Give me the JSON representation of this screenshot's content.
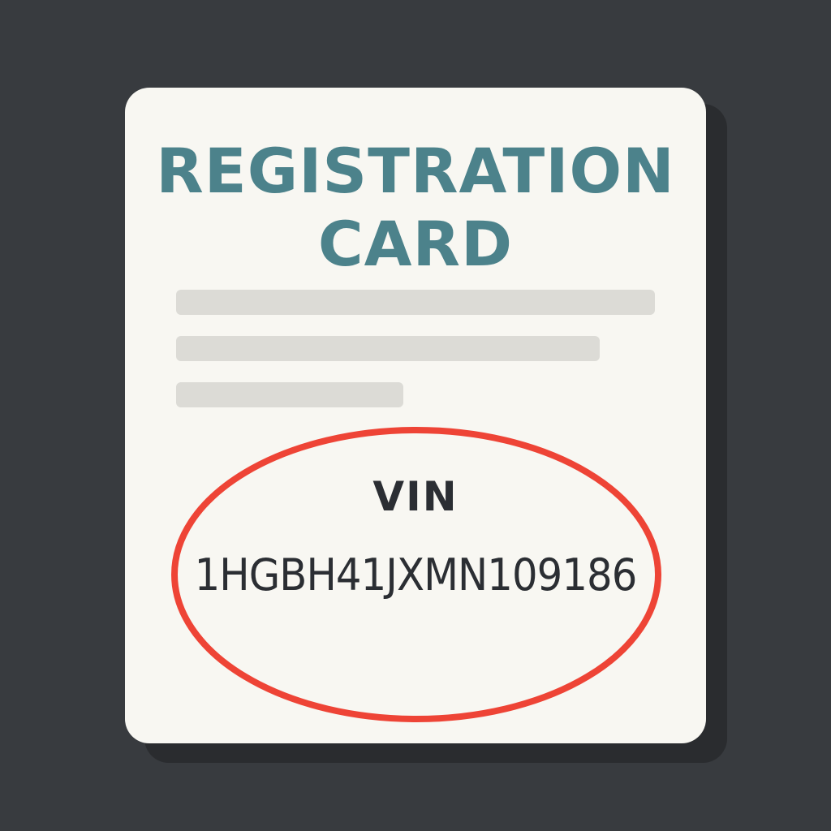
{
  "card": {
    "title_line_1": "REGISTRATION",
    "title_line_2": "CARD",
    "vin_label": "VIN",
    "vin_number": "1HGBH41JXMN109186"
  },
  "colors": {
    "background": "#383b3f",
    "card": "#f8f7f2",
    "title": "#4c828b",
    "placeholder_bar": "#dcdbd6",
    "highlight_circle": "#ee4436",
    "text": "#2b2e33"
  }
}
